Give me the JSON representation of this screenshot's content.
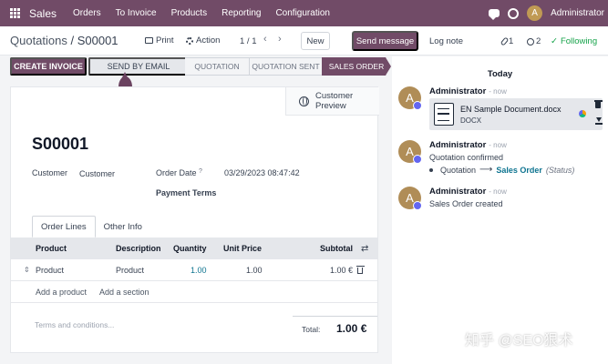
{
  "topbar": {
    "app_name": "Sales",
    "menu": [
      "Orders",
      "To Invoice",
      "Products",
      "Reporting",
      "Configuration"
    ],
    "user_initial": "A",
    "user_name": "Administrator"
  },
  "control": {
    "breadcrumb_parent": "Quotations",
    "breadcrumb_sep": " / ",
    "breadcrumb_current": "S00001",
    "print_label": "Print",
    "action_label": "Action",
    "pager": "1 / 1",
    "pager_prev": "‹",
    "pager_next": "›",
    "new_label": "New",
    "send_message_label": "Send message",
    "log_note_label": "Log note",
    "attachment_count": "1",
    "follower_count": "2",
    "following_label": "Following",
    "check_mark": "✓"
  },
  "statusbar": {
    "create_invoice_label": "CREATE INVOICE",
    "send_email_label": "SEND BY EMAIL",
    "stages": [
      "QUOTATION",
      "QUOTATION SENT",
      "SALES ORDER"
    ],
    "active_stage": "SALES ORDER"
  },
  "form": {
    "preview_label_1": "Customer",
    "preview_label_2": "Preview",
    "order_name": "S00001",
    "customer_label": "Customer",
    "customer_value": "Customer",
    "order_date_label": "Order Date",
    "order_date_help": "?",
    "order_date_value": "03/29/2023 08:47:42",
    "payment_terms_label": "Payment Terms",
    "tabs": [
      "Order Lines",
      "Other Info"
    ],
    "columns": {
      "product": "Product",
      "description": "Description",
      "quantity": "Quantity",
      "unit_price": "Unit Price",
      "subtotal": "Subtotal"
    },
    "lines": [
      {
        "product": "Product",
        "description": "Product",
        "quantity": "1.00",
        "unit_price": "1.00",
        "subtotal": "1.00 €"
      }
    ],
    "add_product_label": "Add a product",
    "add_section_label": "Add a section",
    "terms_placeholder": "Terms and conditions...",
    "total_label": "Total:",
    "total_value": "1.00 €"
  },
  "chatter": {
    "today_label": "Today",
    "messages": [
      {
        "initial": "A",
        "author": "Administrator",
        "time": "- now",
        "attachment_name": "EN Sample Document.docx",
        "attachment_type": "DOCX"
      },
      {
        "initial": "A",
        "author": "Administrator",
        "time": "- now",
        "body": "Quotation confirmed",
        "tracking_old": "Quotation",
        "tracking_arrow": "⟶",
        "tracking_new": "Sales Order",
        "tracking_field": "(Status)"
      },
      {
        "initial": "A",
        "author": "Administrator",
        "time": "- now",
        "body": "Sales Order created"
      }
    ]
  },
  "icons": {
    "drag_handle": "⇕",
    "swap": "⇄"
  },
  "watermark": "知乎 @SEO狠术",
  "colors": {
    "brand": "#714b67",
    "link": "#0e7490",
    "following": "#16a34a"
  }
}
